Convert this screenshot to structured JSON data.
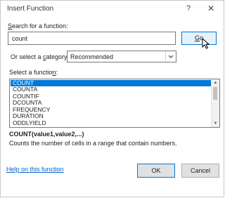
{
  "dialog": {
    "title": "Insert Function",
    "help_glyph": "?",
    "close_glyph": "✕"
  },
  "search": {
    "label_prefix": "",
    "label_hotkey": "S",
    "label_rest": "earch for a function:",
    "value": "count",
    "go_hotkey": "G",
    "go_rest": "o"
  },
  "category": {
    "label_prefix": "Or select a ",
    "label_hotkey": "c",
    "label_rest": "ategory:",
    "value": "Recommended"
  },
  "functions": {
    "label_prefix": "Select a functio",
    "label_hotkey": "n",
    "label_rest": ":",
    "items": [
      "COUNT",
      "COUNTA",
      "COUNTIF",
      "DCOUNTA",
      "FREQUENCY",
      "DURATION",
      "ODDLYIELD"
    ],
    "selected_index": 0
  },
  "details": {
    "syntax": "COUNT(value1,value2,...)",
    "description": "Counts the number of cells in a range that contain numbers."
  },
  "footer": {
    "help_link": "Help on this function",
    "ok": "OK",
    "cancel": "Cancel"
  },
  "colors": {
    "accent": "#0078d7",
    "link": "#0066cc"
  }
}
